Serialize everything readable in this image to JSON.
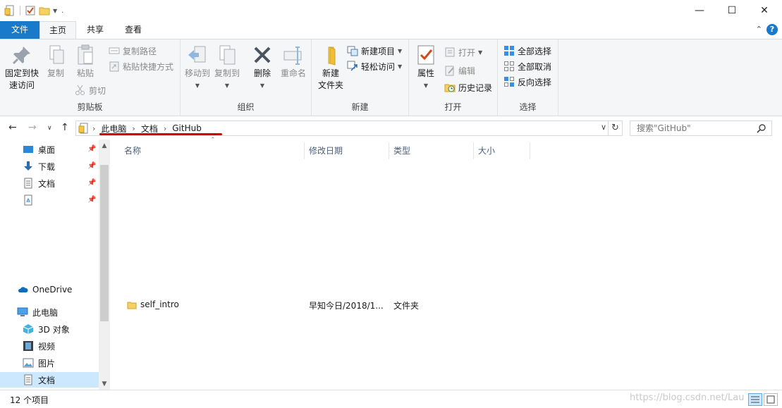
{
  "titlebar": {
    "qat_more": ".",
    "controls": {
      "minimize": "—",
      "maximize": "☐",
      "close": "✕"
    }
  },
  "tabs": {
    "file": "文件",
    "home": "主页",
    "share": "共享",
    "view": "查看"
  },
  "ribbon": {
    "clipboard": {
      "label": "剪贴板",
      "pin_line1": "固定到快",
      "pin_line2": "速访问",
      "copy": "复制",
      "paste": "粘贴",
      "copy_path": "复制路径",
      "paste_shortcut": "粘贴快捷方式",
      "cut": "剪切"
    },
    "organize": {
      "label": "组织",
      "move_to": "移动到",
      "copy_to": "复制到",
      "delete": "删除",
      "rename": "重命名"
    },
    "new": {
      "label": "新建",
      "new_folder_line1": "新建",
      "new_folder_line2": "文件夹",
      "new_item": "新建项目",
      "easy_access": "轻松访问"
    },
    "open": {
      "label": "打开",
      "properties": "属性",
      "open": "打开",
      "edit": "编辑",
      "history": "历史记录"
    },
    "select": {
      "label": "选择",
      "select_all": "全部选择",
      "select_none": "全部取消",
      "invert": "反向选择"
    }
  },
  "address": {
    "crumbs": [
      "此电脑",
      "文档",
      "GitHub"
    ],
    "search_placeholder": "搜索\"GitHub\""
  },
  "nav": {
    "quick": [
      {
        "label": "桌面",
        "icon": "desktop-icon"
      },
      {
        "label": "下载",
        "icon": "download-icon"
      },
      {
        "label": "文档",
        "icon": "document-icon"
      },
      {
        "label": "",
        "icon": "recycle-icon"
      }
    ],
    "onedrive": "OneDrive",
    "thispc": "此电脑",
    "pc_items": [
      {
        "label": "3D 对象",
        "icon": "3d-objects-icon"
      },
      {
        "label": "视频",
        "icon": "video-icon"
      },
      {
        "label": "图片",
        "icon": "pictures-icon"
      },
      {
        "label": "文档",
        "icon": "document-icon"
      }
    ]
  },
  "columns": {
    "name": "名称",
    "modified": "修改日期",
    "type": "类型",
    "size": "大小"
  },
  "files": [
    {
      "name": "self_intro",
      "modified": "早知今日/2018/1...",
      "type": "文件夹"
    }
  ],
  "status": {
    "count": "12 个项目",
    "watermark": "https://blog.csdn.net/Lau"
  },
  "colors": {
    "accent": "#1979ca",
    "selected": "#cce8ff",
    "annotation": "#d40000"
  }
}
